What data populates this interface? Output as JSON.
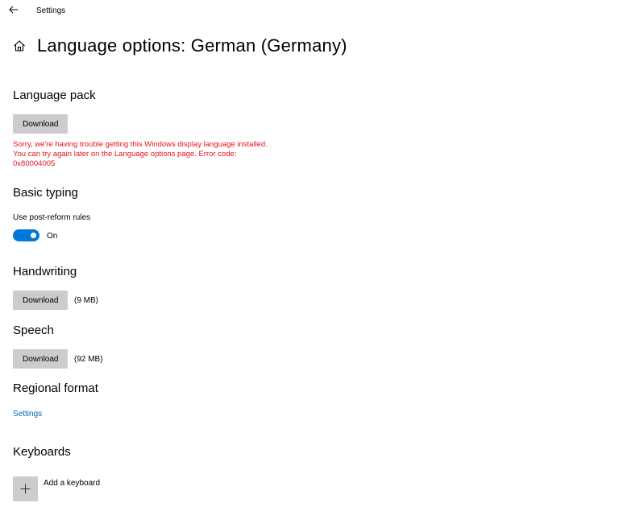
{
  "window": {
    "app_title": "Settings"
  },
  "header": {
    "title": "Language options: German (Germany)"
  },
  "language_pack": {
    "title": "Language pack",
    "download_label": "Download",
    "error_text": "Sorry, we're having trouble getting this Windows display language installed. You can try again later on the Language options page. Error code: 0x80004005",
    "error_color": "#e81123"
  },
  "basic_typing": {
    "title": "Basic typing",
    "option_label": "Use post-reform rules",
    "toggle_state": "On",
    "toggle_on": true,
    "accent_color": "#0078d7"
  },
  "handwriting": {
    "title": "Handwriting",
    "download_label": "Download",
    "size": "(9 MB)"
  },
  "speech": {
    "title": "Speech",
    "download_label": "Download",
    "size": "(92 MB)"
  },
  "regional_format": {
    "title": "Regional format",
    "link_label": "Settings",
    "link_color": "#0067b8"
  },
  "keyboards": {
    "title": "Keyboards",
    "add_label": "Add a keyboard",
    "add_icon": "plus-icon"
  },
  "icons": {
    "back": "back-arrow-icon",
    "home": "home-icon"
  }
}
